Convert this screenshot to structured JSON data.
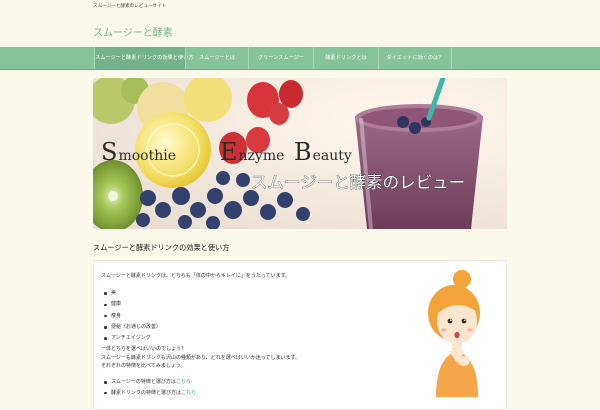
{
  "header": {
    "tagline": "スムージーと酵素のレビューサイト",
    "site_title": "スムージーと酵素"
  },
  "nav": {
    "items": [
      {
        "label": "スムージーと酵素ドリンクの効果と使い方"
      },
      {
        "label": "スムージーとは"
      },
      {
        "label": "グリーンスムージー"
      },
      {
        "label": "酵素ドリンクとは"
      },
      {
        "label": "ダイエットに効くのは？"
      }
    ]
  },
  "hero": {
    "title_letters": [
      "S",
      "moothie",
      "E",
      "nzyme",
      "B",
      "eauty"
    ],
    "subtitle": "スムージーと酵素のレビュー"
  },
  "main": {
    "section_title": "スムージーと酵素ドリンクの効果と使い方",
    "intro": "スムージーと酵素ドリンクは、どちらも「体の中からキレイに」をうたっています。",
    "bullets": [
      "美",
      "健康",
      "痩身",
      "便秘（お通じの改善）",
      "アンチエイジング"
    ],
    "para": [
      "一体どちらを選べばいいのでしょう？",
      "スムージーも酵素ドリンクも沢山の種類があり、どれを選べばいいか迷ってしまいます。",
      "それぞれの特徴を比べてみましょう。"
    ],
    "links": [
      {
        "text": "スムージーの特徴と選び方はこちら",
        "link": "こちら"
      },
      {
        "text": "酵素ドリンクの特徴と選び方はこちら",
        "link": "こちら"
      }
    ]
  },
  "colors": {
    "background": "#fbf8ec",
    "nav": "#85c39a",
    "nav_active": "#73b28a",
    "title_green": "#79b685",
    "link": "#4aa85e"
  }
}
